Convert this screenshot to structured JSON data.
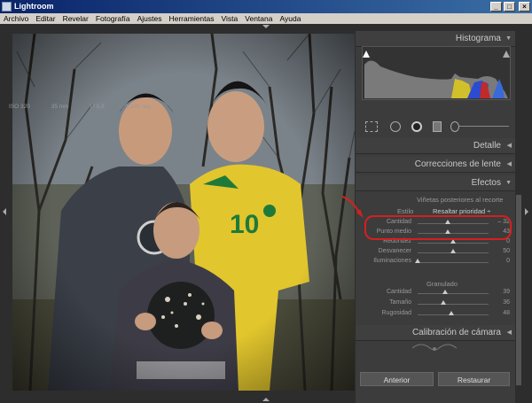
{
  "window": {
    "title": "Lightroom"
  },
  "menu": [
    "Archivo",
    "Editar",
    "Revelar",
    "Fotografía",
    "Ajustes",
    "Herramientas",
    "Vista",
    "Ventana",
    "Ayuda"
  ],
  "panels": {
    "histogram": {
      "title": "Histograma",
      "iso": "ISO 320",
      "focal": "35 mm",
      "aperture": "f / 5,6",
      "shutter": "1/160 seg."
    },
    "detalle": "Detalle",
    "lens": "Correcciones de lente",
    "effects": {
      "title": "Efectos",
      "vignette_section": "Viñetas posteriores al recorte",
      "style_label": "Estilo",
      "style_value": "Resaltar prioridad ÷",
      "vignette_sliders": [
        {
          "label": "Cantidad",
          "value": "– 32",
          "level": 0.42
        },
        {
          "label": "Punto medio",
          "value": "43",
          "level": 0.43
        },
        {
          "label": "Redondez",
          "value": "0",
          "level": 0.5
        },
        {
          "label": "Desvanecer",
          "value": "50",
          "level": 0.5
        },
        {
          "label": "Iluminaciones",
          "value": "0",
          "level": 0.0
        }
      ],
      "grain_section": "Granulado",
      "grain_sliders": [
        {
          "label": "Cantidad",
          "value": "39",
          "level": 0.39
        },
        {
          "label": "Tamaño",
          "value": "36",
          "level": 0.36
        },
        {
          "label": "Rugosidad",
          "value": "48",
          "level": 0.48
        }
      ]
    },
    "calibration": "Calibración de cámara"
  },
  "buttons": {
    "previous": "Anterior",
    "reset": "Restaurar"
  },
  "photo": {
    "shirt_number": "10"
  },
  "colors": {
    "highlight": "#d42020",
    "panel_bg": "#3c3c3c"
  }
}
